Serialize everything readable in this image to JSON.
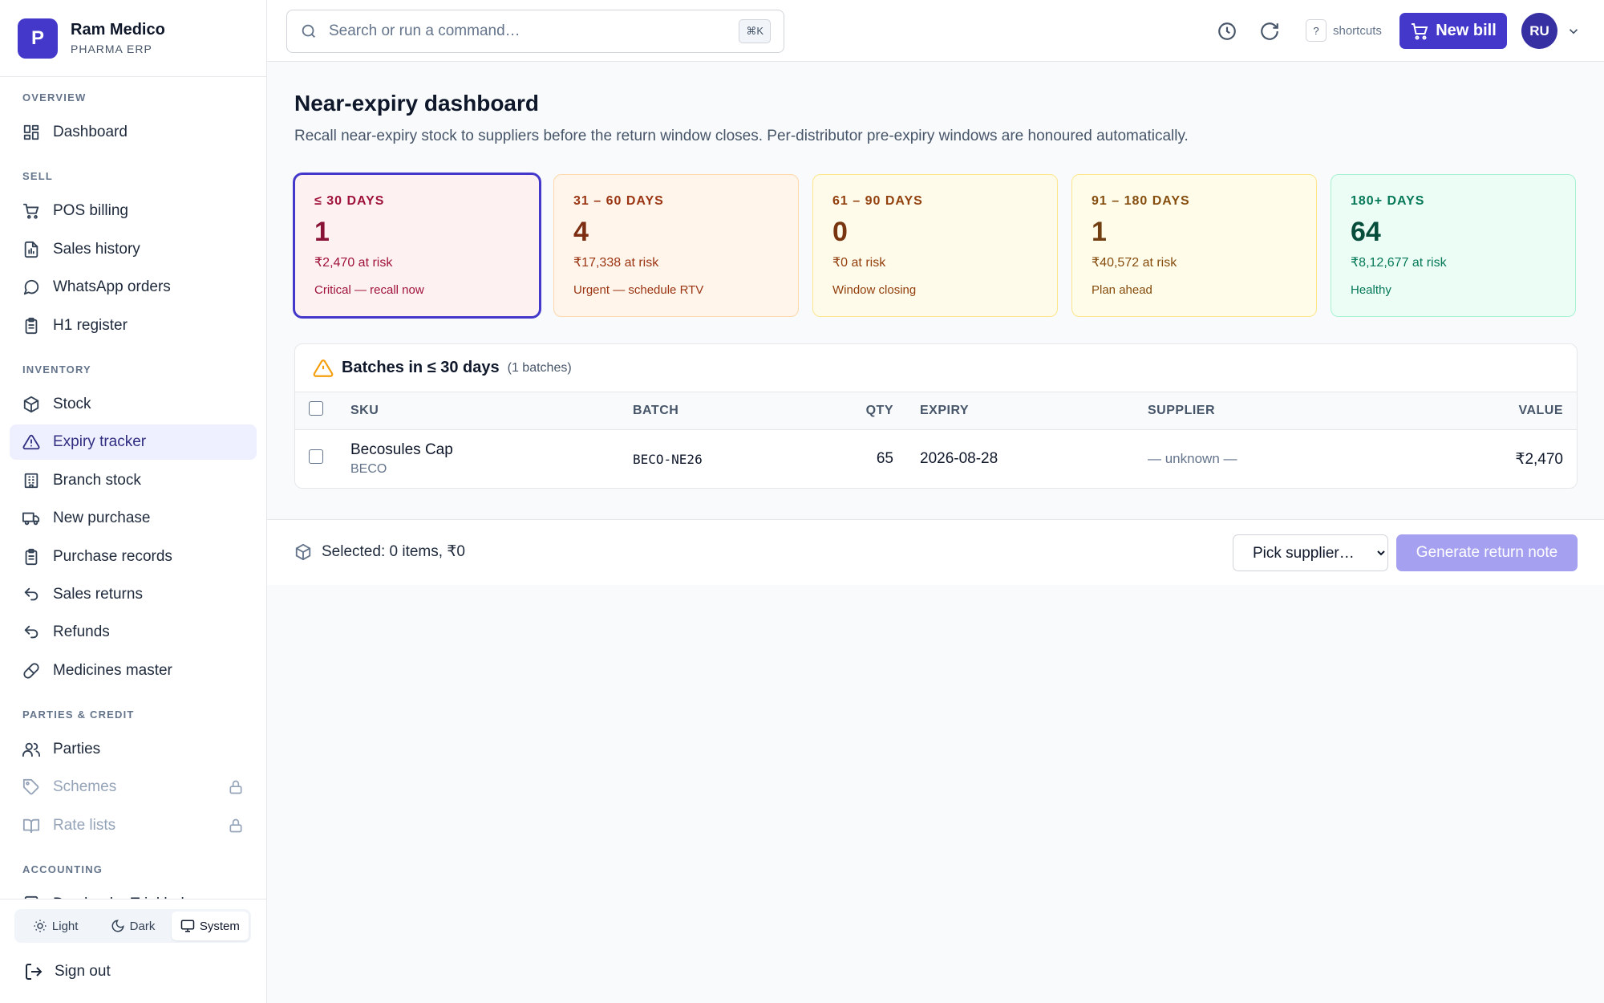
{
  "brand": {
    "logo_letter": "P",
    "name": "Ram Medico",
    "subtitle": "PHARMA ERP"
  },
  "sidebar": {
    "sections": [
      {
        "title": "OVERVIEW",
        "items": [
          {
            "label": "Dashboard",
            "icon": "dashboard-icon"
          }
        ]
      },
      {
        "title": "SELL",
        "items": [
          {
            "label": "POS billing",
            "icon": "cart-icon"
          },
          {
            "label": "Sales history",
            "icon": "report-icon"
          },
          {
            "label": "WhatsApp orders",
            "icon": "chat-icon"
          },
          {
            "label": "H1 register",
            "icon": "clipboard-icon"
          }
        ]
      },
      {
        "title": "INVENTORY",
        "items": [
          {
            "label": "Stock",
            "icon": "box-icon"
          },
          {
            "label": "Expiry tracker",
            "icon": "warning-icon",
            "active": true
          },
          {
            "label": "Branch stock",
            "icon": "building-icon"
          },
          {
            "label": "New purchase",
            "icon": "truck-icon"
          },
          {
            "label": "Purchase records",
            "icon": "clipboard-icon"
          },
          {
            "label": "Sales returns",
            "icon": "undo-icon"
          },
          {
            "label": "Refunds",
            "icon": "undo-icon"
          },
          {
            "label": "Medicines master",
            "icon": "pill-icon"
          }
        ]
      },
      {
        "title": "PARTIES & CREDIT",
        "items": [
          {
            "label": "Parties",
            "icon": "users-icon"
          },
          {
            "label": "Schemes",
            "icon": "tag-icon",
            "locked": true
          },
          {
            "label": "Rate lists",
            "icon": "book-icon",
            "locked": true
          }
        ]
      },
      {
        "title": "ACCOUNTING",
        "items": [
          {
            "label": "Day book · Trial balance",
            "icon": "calculator-icon"
          }
        ]
      }
    ],
    "theme": {
      "light": "Light",
      "dark": "Dark",
      "system": "System",
      "selected": "System"
    },
    "sign_out": "Sign out"
  },
  "topbar": {
    "search_placeholder": "Search or run a command…",
    "search_shortcut": "⌘K",
    "shortcuts_key": "?",
    "shortcuts_label": "shortcuts",
    "new_bill": "New bill",
    "avatar_initials": "RU"
  },
  "page": {
    "title": "Near-expiry dashboard",
    "description": "Recall near-expiry stock to suppliers before the return window closes. Per-distributor pre-expiry windows are honoured automatically."
  },
  "buckets": [
    {
      "label": "≤ 30 DAYS",
      "count": "1",
      "risk": "₹2,470 at risk",
      "note": "Critical — recall now",
      "bg": "#fef1f2",
      "border": "#fecdd3",
      "label_color": "#9f1239",
      "count_color": "#881337",
      "text_color": "#9f1239",
      "selected": true
    },
    {
      "label": "31 – 60 DAYS",
      "count": "4",
      "risk": "₹17,338 at risk",
      "note": "Urgent — schedule RTV",
      "bg": "#fff5eb",
      "border": "#fed7aa",
      "label_color": "#9a3412",
      "count_color": "#7c2d12",
      "text_color": "#9a3412"
    },
    {
      "label": "61 – 90 DAYS",
      "count": "0",
      "risk": "₹0 at risk",
      "note": "Window closing",
      "bg": "#fffbea",
      "border": "#fde68a",
      "label_color": "#92400e",
      "count_color": "#78350f",
      "text_color": "#92400e"
    },
    {
      "label": "91 – 180 DAYS",
      "count": "1",
      "risk": "₹40,572 at risk",
      "note": "Plan ahead",
      "bg": "#fffcea",
      "border": "#fde68a",
      "label_color": "#854d0e",
      "count_color": "#713f12",
      "text_color": "#854d0e"
    },
    {
      "label": "180+ DAYS",
      "count": "64",
      "risk": "₹8,12,677 at risk",
      "note": "Healthy",
      "bg": "#ecfdf5",
      "border": "#a7f3d0",
      "label_color": "#047857",
      "count_color": "#064e3b",
      "text_color": "#047857"
    }
  ],
  "batches": {
    "title": "Batches in ≤ 30 days",
    "count_text": "(1 batches)",
    "columns": {
      "sku": "SKU",
      "batch": "BATCH",
      "qty": "QTY",
      "expiry": "EXPIRY",
      "supplier": "SUPPLIER",
      "value": "VALUE"
    },
    "rows": [
      {
        "sku": "Becosules Cap",
        "sku_code": "BECO",
        "batch": "BECO-NE26",
        "qty": "65",
        "expiry": "2026-08-28",
        "supplier": "— unknown —",
        "value": "₹2,470"
      }
    ]
  },
  "action_bar": {
    "selected_text": "Selected: 0 items, ₹0",
    "supplier_select": "Pick supplier…",
    "generate_button": "Generate return note"
  },
  "colors": {
    "accent": "#4338ca",
    "accent_disabled": "#a5a0f0",
    "active_nav_bg": "#eef0ff"
  }
}
